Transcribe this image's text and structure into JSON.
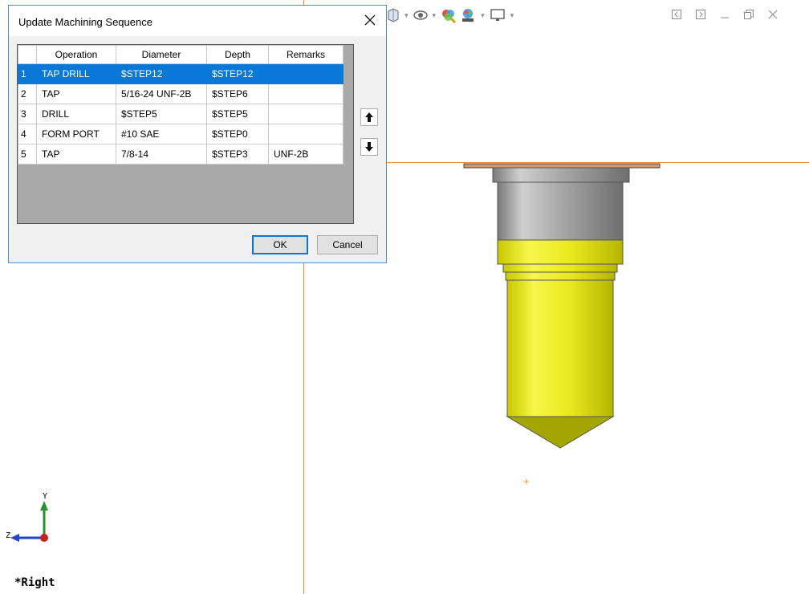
{
  "dialog": {
    "title": "Update Machining Sequence",
    "columns": [
      "",
      "Operation",
      "Diameter",
      "Depth",
      "Remarks"
    ],
    "rows": [
      {
        "num": "1",
        "operation": "TAP DRILL",
        "diameter": "$STEP12",
        "depth": "$STEP12",
        "remarks": "",
        "selected": true
      },
      {
        "num": "2",
        "operation": "TAP",
        "diameter": "5/16-24 UNF-2B",
        "depth": "$STEP6",
        "remarks": ""
      },
      {
        "num": "3",
        "operation": "DRILL",
        "diameter": "$STEP5",
        "depth": "$STEP5",
        "remarks": ""
      },
      {
        "num": "4",
        "operation": "FORM PORT",
        "diameter": "#10 SAE",
        "depth": "$STEP0",
        "remarks": ""
      },
      {
        "num": "5",
        "operation": "TAP",
        "diameter": "7/8-14",
        "depth": "$STEP3",
        "remarks": "UNF-2B"
      }
    ],
    "ok_label": "OK",
    "cancel_label": "Cancel",
    "move_up_icon": "arrow-up-icon",
    "move_down_icon": "arrow-down-icon"
  },
  "viewport": {
    "view_label": "*Right",
    "axis_y_label": "Y",
    "axis_z_label": "Z",
    "origin_marker": "+",
    "part_color": "#f2f22a",
    "axis_line_color": "#f08a24",
    "toolbar_icons": [
      "view-cube-icon",
      "visibility-icon",
      "appearance-icon",
      "scene-icon",
      "display-icon"
    ]
  },
  "window_controls": [
    "collapse-left-icon",
    "collapse-right-icon",
    "minimize-icon",
    "restore-icon",
    "close-icon"
  ]
}
